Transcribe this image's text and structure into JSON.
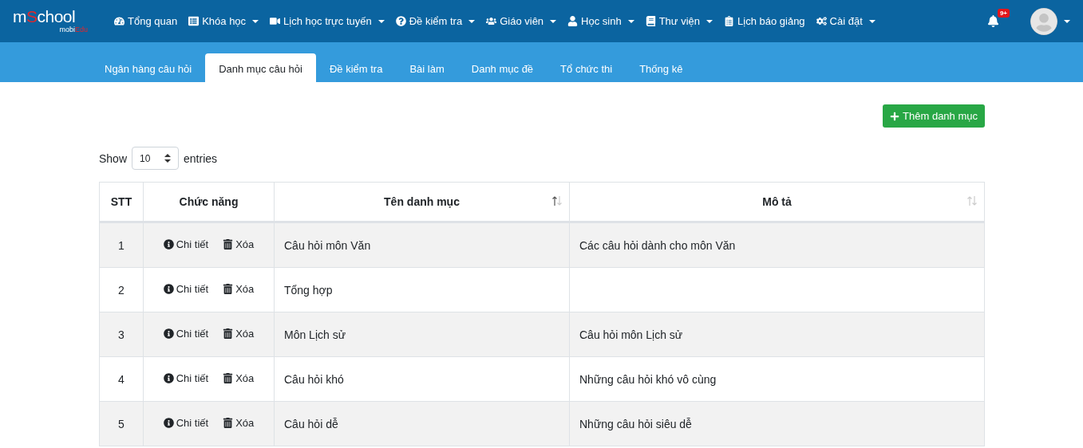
{
  "logo": {
    "main": [
      "m",
      "S",
      "chool"
    ],
    "sub": [
      "mobi",
      "Edu"
    ]
  },
  "nav": [
    {
      "label": "Tổng quan",
      "dropdown": false
    },
    {
      "label": "Khóa học",
      "dropdown": true
    },
    {
      "label": "Lịch học trực tuyến",
      "dropdown": true
    },
    {
      "label": "Đề kiểm tra",
      "dropdown": true
    },
    {
      "label": "Giáo viên",
      "dropdown": true
    },
    {
      "label": "Học sinh",
      "dropdown": true
    },
    {
      "label": "Thư viện",
      "dropdown": true
    },
    {
      "label": "Lịch báo giảng",
      "dropdown": false
    },
    {
      "label": "Cài đặt",
      "dropdown": true
    }
  ],
  "notifications": {
    "badge": "9+"
  },
  "tabs": [
    {
      "label": "Ngân hàng câu hỏi",
      "selected": false
    },
    {
      "label": "Danh mục câu hỏi",
      "selected": true
    },
    {
      "label": "Đề kiểm tra",
      "selected": false
    },
    {
      "label": "Bài làm",
      "selected": false
    },
    {
      "label": "Danh mục đề",
      "selected": false
    },
    {
      "label": "Tổ chức thi",
      "selected": false
    },
    {
      "label": "Thống kê",
      "selected": false
    }
  ],
  "add_button": "Thêm danh mục",
  "length": {
    "before": "Show",
    "value": "10",
    "after": "entries"
  },
  "table": {
    "columns": [
      {
        "label": "STT"
      },
      {
        "label": "Chức năng"
      },
      {
        "label": "Tên danh mục",
        "sorted": true
      },
      {
        "label": "Mô tả",
        "sorted": false
      }
    ],
    "rows": [
      {
        "stt": "1",
        "detail": "Chi tiết",
        "delete": "Xóa",
        "name": "Câu hỏi môn Văn",
        "description": "Các câu hỏi dành cho môn Văn"
      },
      {
        "stt": "2",
        "detail": "Chi tiết",
        "delete": "Xóa",
        "name": "Tổng hợp"
      },
      {
        "stt": "3",
        "detail": "Chi tiết",
        "delete": "Xóa",
        "name": "Môn Lịch sử",
        "description": "Câu hỏi môn Lịch sử"
      },
      {
        "stt": "4",
        "detail": "Chi tiết",
        "delete": "Xóa",
        "name": "Câu hỏi khó",
        "description": "Những câu hỏi khó vô cùng"
      },
      {
        "stt": "5",
        "detail": "Chi tiết",
        "delete": "Xóa",
        "name": "Câu hỏi dễ",
        "description": "Những câu hỏi siêu dễ"
      }
    ]
  }
}
